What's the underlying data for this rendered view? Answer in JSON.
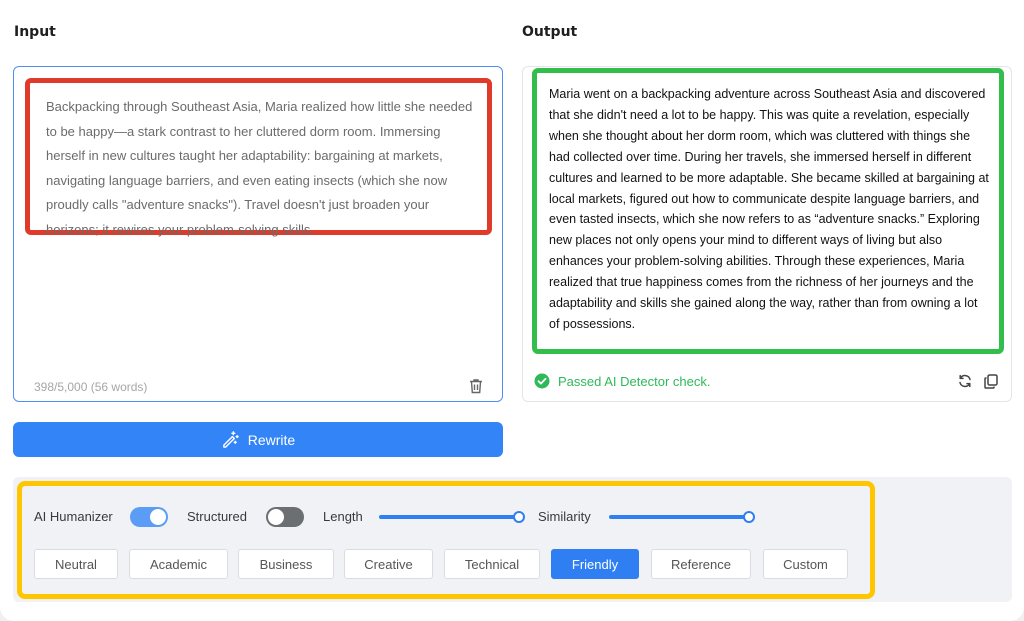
{
  "input": {
    "title": "Input",
    "text": "Backpacking through Southeast Asia, Maria realized how little she needed to be happy—a stark contrast to her cluttered dorm room. Immersing herself in new cultures taught her adaptability: bargaining at markets, navigating language barriers, and even eating insects (which she now proudly calls \"adventure snacks\"). Travel doesn't just broaden your horizons; it rewires your problem-solving skills.",
    "counter": "398/5,000 (56 words)"
  },
  "output": {
    "title": "Output",
    "text": "Maria went on a backpacking adventure across Southeast Asia and discovered that she didn't need a lot to be happy. This was quite a revelation, especially when she thought about her dorm room, which was cluttered with things she had collected over time. During her travels, she immersed herself in different cultures and learned to be more adaptable. She became skilled at bargaining at local markets, figured out how to communicate despite language barriers, and even tasted insects, which she now refers to as “adventure snacks.” Exploring new places not only opens your mind to different ways of living but also enhances your problem-solving abilities. Through these experiences, Maria realized that true happiness comes from the richness of her journeys and the adaptability and skills she gained along the way, rather than from owning a lot of possessions.",
    "status": "Passed AI Detector check."
  },
  "rewrite_label": "Rewrite",
  "controls": {
    "ai_humanizer": {
      "label": "AI Humanizer",
      "on": true
    },
    "structured": {
      "label": "Structured",
      "on": false
    },
    "length": {
      "label": "Length",
      "value": 1.0
    },
    "similarity": {
      "label": "Similarity",
      "value": 1.0
    }
  },
  "modes": [
    "Neutral",
    "Academic",
    "Business",
    "Creative",
    "Technical",
    "Friendly",
    "Reference",
    "Custom"
  ],
  "active_mode": "Friendly",
  "colors": {
    "primary": "#3385f7",
    "success": "#2fb95a",
    "highlight_input": "#e03a2a",
    "highlight_output": "#33bd4a",
    "highlight_settings": "#ffc600"
  },
  "icons": {
    "trash": "trash-icon",
    "check": "check-circle-icon",
    "refresh": "refresh-icon",
    "copy": "copy-icon",
    "rewrite": "magic-pen-icon"
  }
}
